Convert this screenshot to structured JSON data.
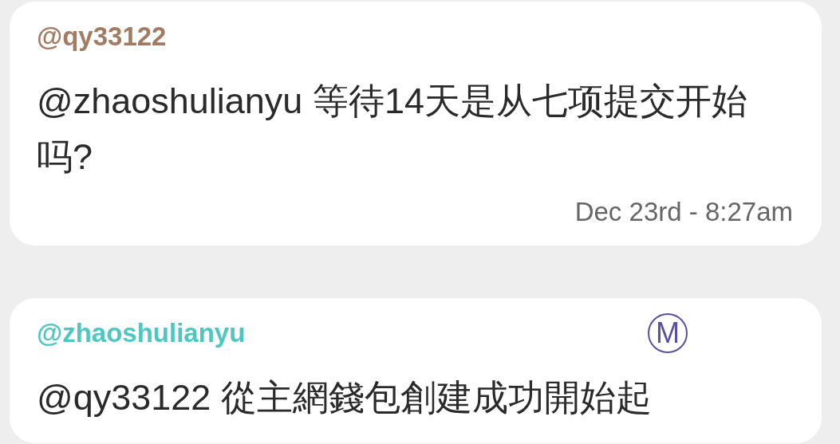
{
  "messages": [
    {
      "author": "@qy33122",
      "color": "#a27b62",
      "text": "@zhaoshulianyu 等待14天是从七项提交开始吗?",
      "time": "Dec 23rd - 8:27am"
    },
    {
      "author": "@zhaoshulianyu",
      "color": "#4ec7c0",
      "badge": "M",
      "text": "@qy33122 從主網錢包創建成功開始起"
    }
  ]
}
